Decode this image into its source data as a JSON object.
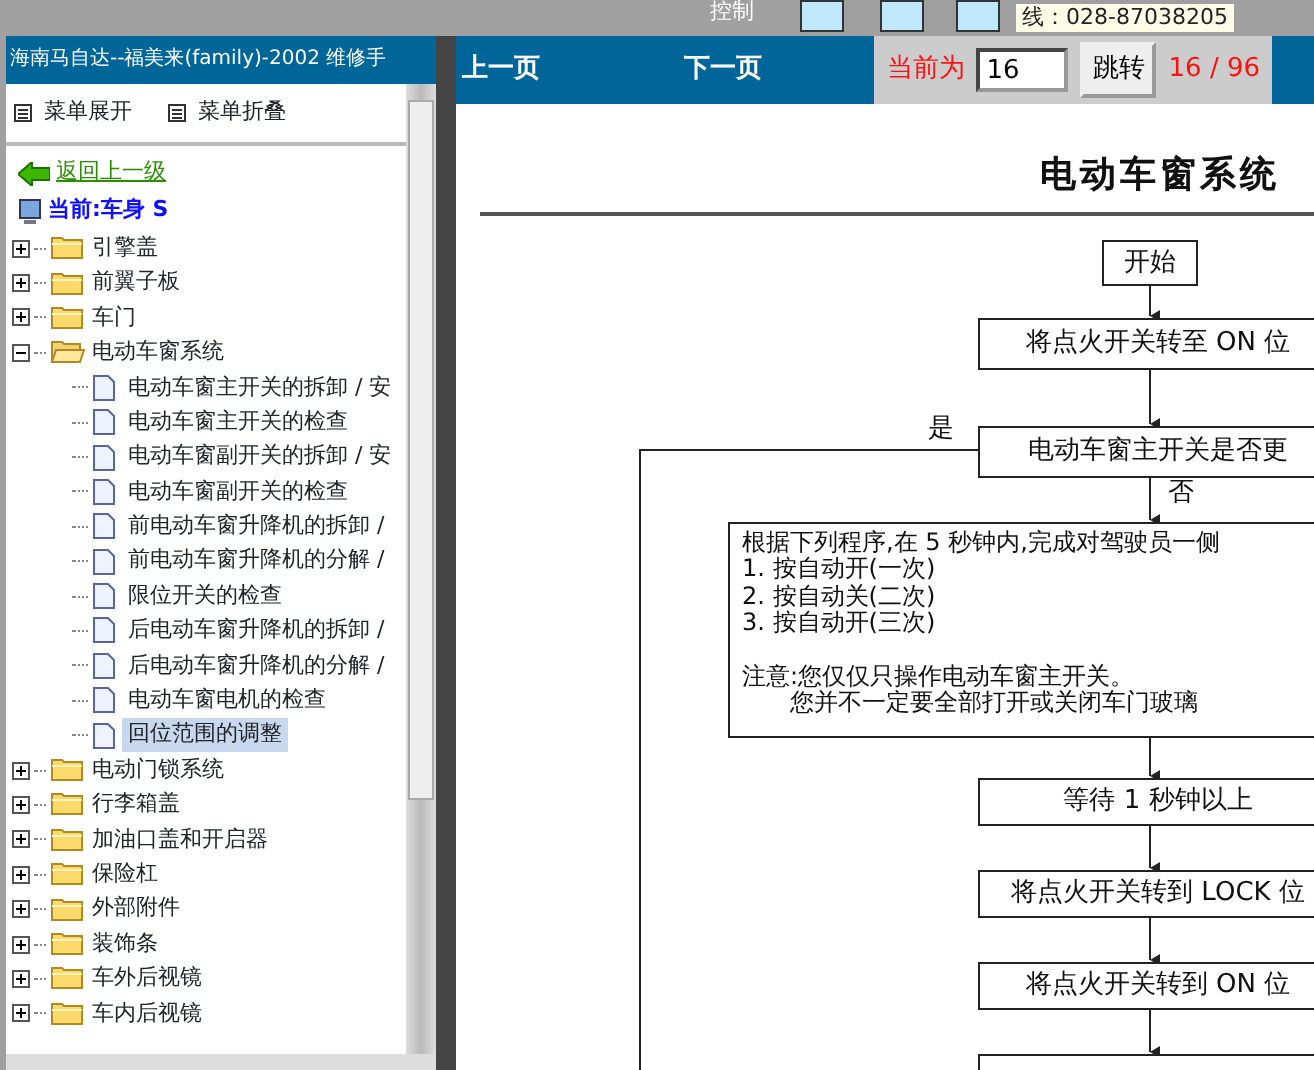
{
  "top_strip": {
    "label": "控制",
    "contact_line": "线：028-87038205"
  },
  "left_panel": {
    "title": "海南马自达--福美来(family)-2002 维修手",
    "menu_buttons": [
      {
        "label": "菜单展开"
      },
      {
        "label": "菜单折叠"
      }
    ],
    "back_link": "返回上一级",
    "current": "当前:车身 S",
    "tree": [
      {
        "label": "引擎盖",
        "expanded": false
      },
      {
        "label": "前翼子板",
        "expanded": false
      },
      {
        "label": "车门",
        "expanded": false
      },
      {
        "label": "电动车窗系统",
        "expanded": true,
        "children": [
          {
            "label": "电动车窗主开关的拆卸 / 安",
            "selected": false
          },
          {
            "label": "电动车窗主开关的检查",
            "selected": false
          },
          {
            "label": "电动车窗副开关的拆卸 / 安",
            "selected": false
          },
          {
            "label": "电动车窗副开关的检查",
            "selected": false
          },
          {
            "label": "前电动车窗升降机的拆卸 /",
            "selected": false
          },
          {
            "label": "前电动车窗升降机的分解 /",
            "selected": false
          },
          {
            "label": "限位开关的检查",
            "selected": false
          },
          {
            "label": "后电动车窗升降机的拆卸 /",
            "selected": false
          },
          {
            "label": "后电动车窗升降机的分解 /",
            "selected": false
          },
          {
            "label": "电动车窗电机的检查",
            "selected": false
          },
          {
            "label": "回位范围的调整",
            "selected": true
          }
        ]
      },
      {
        "label": "电动门锁系统",
        "expanded": false
      },
      {
        "label": "行李箱盖",
        "expanded": false
      },
      {
        "label": "加油口盖和开启器",
        "expanded": false
      },
      {
        "label": "保险杠",
        "expanded": false
      },
      {
        "label": "外部附件",
        "expanded": false
      },
      {
        "label": "装饰条",
        "expanded": false
      },
      {
        "label": "车外后视镜",
        "expanded": false
      },
      {
        "label": "车内后视镜",
        "expanded": false
      }
    ]
  },
  "viewer": {
    "prev": "上一页",
    "next": "下一页",
    "current_label": "当前为",
    "page_input": "16",
    "go_button": "跳转",
    "page_count": "16 / 96",
    "document": {
      "title": "电动车窗系统",
      "flow": [
        {
          "kind": "box",
          "lines": [
            "开始"
          ]
        },
        {
          "kind": "box",
          "lines": [
            "将点火开关转至 ON 位"
          ]
        },
        {
          "kind": "box",
          "lines": [
            "电动车窗主开关是否更"
          ]
        },
        {
          "kind": "label",
          "lines": [
            "是"
          ]
        },
        {
          "kind": "label",
          "lines": [
            "否"
          ]
        },
        {
          "kind": "note",
          "lines": [
            "根据下列程序,在 5 秒钟内,完成对驾驶员一侧",
            "1. 按自动开(一次)",
            "2. 按自动关(二次)",
            "3. 按自动开(三次)"
          ],
          "notes": [
            "注意:您仅仅只操作电动车窗主开关。",
            "　　您并不一定要全部打开或关闭车门玻璃"
          ]
        },
        {
          "kind": "box",
          "lines": [
            "等待 1 秒钟以上"
          ]
        },
        {
          "kind": "box",
          "lines": [
            "将点火开关转到 LOCK 位"
          ]
        },
        {
          "kind": "box",
          "lines": [
            "将点火开关转到 ON 位"
          ]
        },
        {
          "kind": "box"
        }
      ]
    }
  }
}
